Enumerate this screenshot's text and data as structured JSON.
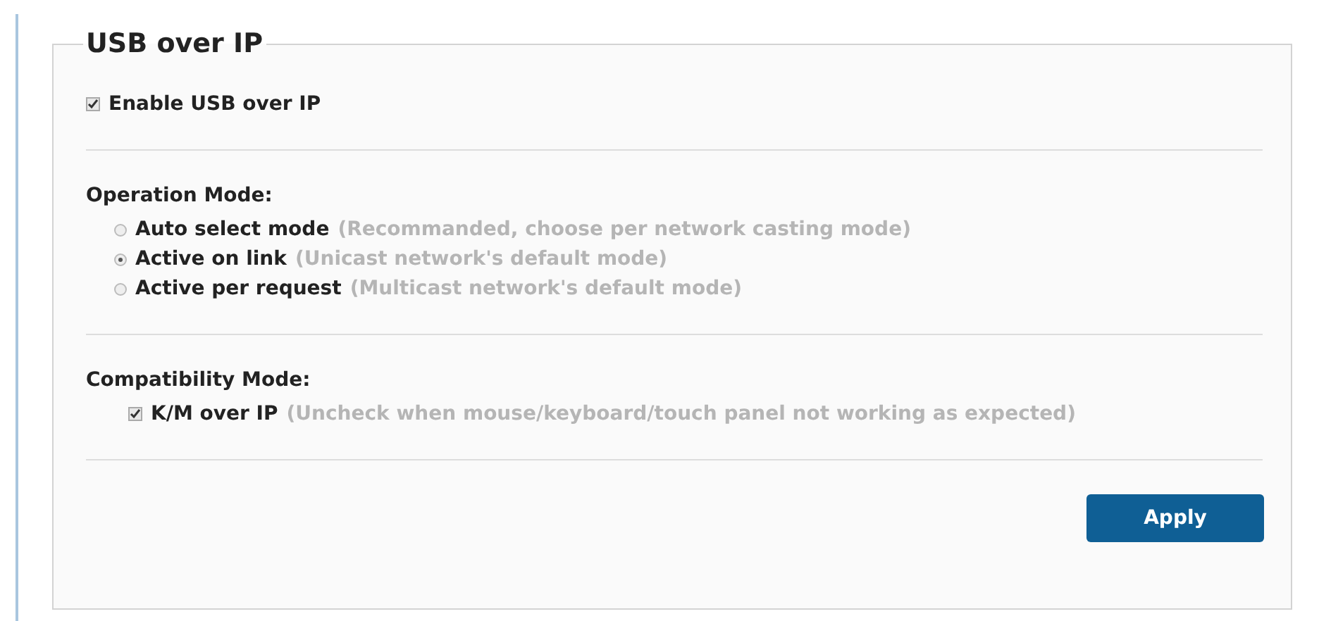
{
  "section": {
    "title": "USB over IP"
  },
  "enable": {
    "label": "Enable USB over IP",
    "checked": true
  },
  "operation_mode": {
    "label": "Operation Mode:",
    "options": [
      {
        "label": "Auto select mode",
        "hint": "(Recommanded, choose per network casting mode)",
        "selected": false
      },
      {
        "label": "Active on link",
        "hint": "(Unicast network's default mode)",
        "selected": true
      },
      {
        "label": "Active per request",
        "hint": "(Multicast network's default mode)",
        "selected": false
      }
    ]
  },
  "compatibility_mode": {
    "label": "Compatibility Mode:",
    "option": {
      "label": "K/M over IP",
      "hint": "(Uncheck when mouse/keyboard/touch panel not working as expected)",
      "checked": true
    }
  },
  "buttons": [
    "Apply"
  ]
}
